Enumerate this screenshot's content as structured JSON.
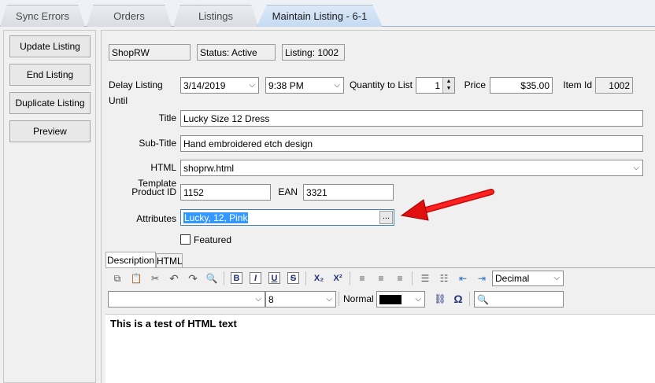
{
  "tabs": [
    {
      "label": "Sync Errors",
      "active": false
    },
    {
      "label": "Orders",
      "active": false
    },
    {
      "label": "Listings",
      "active": false
    },
    {
      "label": "Maintain Listing - 6-1",
      "active": true
    }
  ],
  "sidebar": {
    "buttons": [
      "Update Listing",
      "End Listing",
      "Duplicate Listing",
      "Preview"
    ]
  },
  "header": {
    "store": "ShopRW",
    "status": "Status: Active",
    "listing": "Listing: 1002"
  },
  "form": {
    "delay_label": "Delay Listing Until",
    "delay_date": "3/14/2019",
    "delay_time": "9:38 PM",
    "qty_label": "Quantity to List",
    "qty_value": "1",
    "price_label": "Price",
    "price_value": "$35.00",
    "item_id_label": "Item Id",
    "item_id_value": "1002",
    "title_label": "Title",
    "title_value": "Lucky Size 12 Dress",
    "subtitle_label": "Sub-Title",
    "subtitle_value": "Hand embroidered etch design",
    "template_label": "HTML Template",
    "template_value": "shoprw.html",
    "product_id_label": "Product ID",
    "product_id_value": "1152",
    "ean_label": "EAN",
    "ean_value": "3321",
    "attributes_label": "Attributes",
    "attributes_value": "Lucky, 12, Pink",
    "ellipsis": "...",
    "featured_label": "Featured",
    "featured_checked": false
  },
  "editor": {
    "tabs": [
      "Description",
      "HTML"
    ],
    "list_style": "Decimal",
    "font_name": "",
    "font_size": "8",
    "paragraph_style": "Normal",
    "find_value": "",
    "content": "This is a test of HTML text"
  },
  "colors": {
    "arrow": "#e01010",
    "tab_active": "#c5daf2",
    "selection": "#3399ff"
  }
}
